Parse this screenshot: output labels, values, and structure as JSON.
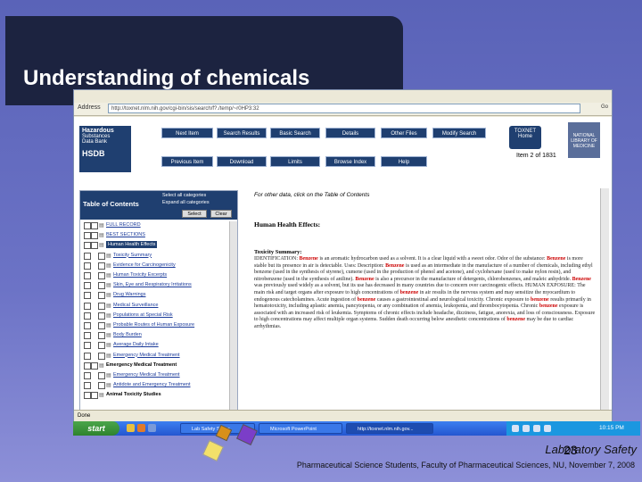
{
  "slide": {
    "title": "Understanding of chemicals",
    "footer_course": "Laboratory Safety",
    "footer_page": "23",
    "footer_credit": "Pharmaceutical Science Students, Faculty of Pharmaceutical Sciences, NU, November 7, 2008"
  },
  "browser": {
    "address_label": "Address",
    "address_url": "http://toxnet.nlm.nih.gov/cgi-bin/sis/search/f?./temp/~r0HP3:32",
    "go_label": "Go",
    "status_text": "Done"
  },
  "hsdb": {
    "logo_lines": [
      "Hazardous",
      "Substances",
      "Data Bank",
      "HSDB"
    ],
    "nav_top": [
      "Next Item",
      "Search Results",
      "Basic Search",
      "Details",
      "Other Files",
      "Modify Search"
    ],
    "nav_bottom": [
      "Previous Item",
      "Download",
      "Limits",
      "Browse Index",
      "Help"
    ],
    "toxnet_label": "TOXNET Home",
    "nlm_label": "NATIONAL LIBRARY OF MEDICINE",
    "item_count": "Item 2 of 1831"
  },
  "toc": {
    "title": "Table of Contents",
    "option_all": "Select all categories",
    "option_expand": "Expand all categories",
    "select_button": "Select",
    "clear_button": "Clear",
    "items": [
      {
        "label": "FULL RECORD",
        "type": "link"
      },
      {
        "label": "BEST SECTIONS",
        "type": "link"
      },
      {
        "label": "Human Health Effects",
        "type": "highlight"
      },
      {
        "label": "Toxicity Summary",
        "type": "link"
      },
      {
        "label": "Evidence for Carcinogenicity",
        "type": "link"
      },
      {
        "label": "Human Toxicity Excerpts",
        "type": "link"
      },
      {
        "label": "Skin, Eye and Respiratory Irritations",
        "type": "link"
      },
      {
        "label": "Drug Warnings",
        "type": "link"
      },
      {
        "label": "Medical Surveillance",
        "type": "link"
      },
      {
        "label": "Populations at Special Risk",
        "type": "link"
      },
      {
        "label": "Probable Routes of Human Exposure",
        "type": "link"
      },
      {
        "label": "Body Burden",
        "type": "link"
      },
      {
        "label": "Average Daily Intake",
        "type": "link"
      },
      {
        "label": "Emergency Medical Treatment",
        "type": "link"
      },
      {
        "label": "Emergency Medical Treatment",
        "type": "section"
      },
      {
        "label": "Emergency Medical Treatment",
        "type": "link"
      },
      {
        "label": "Antidote and Emergency Treatment",
        "type": "link"
      },
      {
        "label": "Animal Toxicity Studies",
        "type": "section"
      }
    ]
  },
  "main": {
    "hint": "For other data, click on the Table of Contents",
    "heading": "Human Health Effects:",
    "subheading": "Toxicity Summary:",
    "body_segments": [
      {
        "t": "IDENTIFICATION: ",
        "hl": false
      },
      {
        "t": "Benzene",
        "hl": true
      },
      {
        "t": " is an aromatic hydrocarbon used as a solvent. It is a clear liquid with a sweet odor. Odor of the substance: ",
        "hl": false
      },
      {
        "t": "Benzene",
        "hl": true
      },
      {
        "t": " is more stable but its presence in air is detectable. Uses: Description: ",
        "hl": false
      },
      {
        "t": "Benzene",
        "hl": true
      },
      {
        "t": " is used as an intermediate in the manufacture of a number of chemicals, including ethyl benzene (used in the synthesis of styrene), cumene (used in the production of phenol and acetone), and cyclohexane (used to make nylon resin), and nitrobenzene (used in the synthesis of aniline). ",
        "hl": false
      },
      {
        "t": "Benzene",
        "hl": true
      },
      {
        "t": " is also a precursor in the manufacture of detergents, chlorobenzenes, and maleic anhydride. ",
        "hl": false
      },
      {
        "t": "Benzene",
        "hl": true
      },
      {
        "t": " was previously used widely as a solvent, but its use has decreased in many countries due to concern over carcinogenic effects. HUMAN EXPOSURE: The main risk and target organs after exposure to high concentrations of ",
        "hl": false
      },
      {
        "t": "benzene",
        "hl": true
      },
      {
        "t": " in air results in the nervous system and may sensitize the myocardium to endogenous catecholamines. Acute ingestion of ",
        "hl": false
      },
      {
        "t": "benzene",
        "hl": true
      },
      {
        "t": " causes a gastrointestinal and neurological toxicity. Chronic exposure to ",
        "hl": false
      },
      {
        "t": "benzene",
        "hl": true
      },
      {
        "t": " results primarily in hematotoxicity, including aplastic anemia, pancytopenia, or any combination of anemia, leukopenia, and thrombocytopenia. Chronic ",
        "hl": false
      },
      {
        "t": "benzene",
        "hl": true
      },
      {
        "t": " exposure is associated with an increased risk of leukemia. Symptoms of chronic effects include headache, dizziness, fatigue, anorexia, and loss of consciousness. Exposure to high concentrations may affect multiple organ systems. Sudden death occurring below anesthetic concentrations of ",
        "hl": false
      },
      {
        "t": "benzene",
        "hl": true
      },
      {
        "t": " may be due to cardiac arrhythmias.",
        "hl": false
      }
    ]
  },
  "taskbar": {
    "start_label": "start",
    "items": [
      "Lab Safety Slides",
      "Microsoft PowerPoint",
      "http://toxnet.nlm.nih.gov..."
    ],
    "clock": "10:15 PM"
  }
}
